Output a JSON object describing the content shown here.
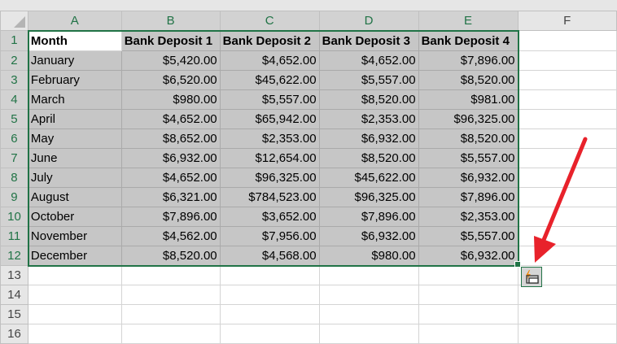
{
  "columns": [
    "A",
    "B",
    "C",
    "D",
    "E",
    "F"
  ],
  "row_numbers": [
    "1",
    "2",
    "3",
    "4",
    "5",
    "6",
    "7",
    "8",
    "9",
    "10",
    "11",
    "12",
    "13",
    "14",
    "15",
    "16"
  ],
  "headers": [
    "Month",
    "Bank Deposit 1",
    "Bank Deposit 2",
    "Bank Deposit 3",
    "Bank Deposit 4"
  ],
  "rows": [
    [
      "January",
      "$5,420.00",
      "$4,652.00",
      "$4,652.00",
      "$7,896.00"
    ],
    [
      "February",
      "$6,520.00",
      "$45,622.00",
      "$5,557.00",
      "$8,520.00"
    ],
    [
      "March",
      "$980.00",
      "$5,557.00",
      "$8,520.00",
      "$981.00"
    ],
    [
      "April",
      "$4,652.00",
      "$65,942.00",
      "$2,353.00",
      "$96,325.00"
    ],
    [
      "May",
      "$8,652.00",
      "$2,353.00",
      "$6,932.00",
      "$8,520.00"
    ],
    [
      "June",
      "$6,932.00",
      "$12,654.00",
      "$8,520.00",
      "$5,557.00"
    ],
    [
      "July",
      "$4,652.00",
      "$96,325.00",
      "$45,622.00",
      "$6,932.00"
    ],
    [
      "August",
      "$6,321.00",
      "$784,523.00",
      "$96,325.00",
      "$7,896.00"
    ],
    [
      "October",
      "$7,896.00",
      "$3,652.00",
      "$7,896.00",
      "$2,353.00"
    ],
    [
      "November",
      "$4,562.00",
      "$7,956.00",
      "$6,932.00",
      "$5,557.00"
    ],
    [
      "December",
      "$8,520.00",
      "$4,568.00",
      "$980.00",
      "$6,932.00"
    ]
  ],
  "colors": {
    "accent": "#217346",
    "arrow": "#e8222b",
    "selection": "#c6c6c6"
  },
  "icons": {
    "paste_options": "quick-analysis-icon",
    "arrow": "red-arrow"
  }
}
